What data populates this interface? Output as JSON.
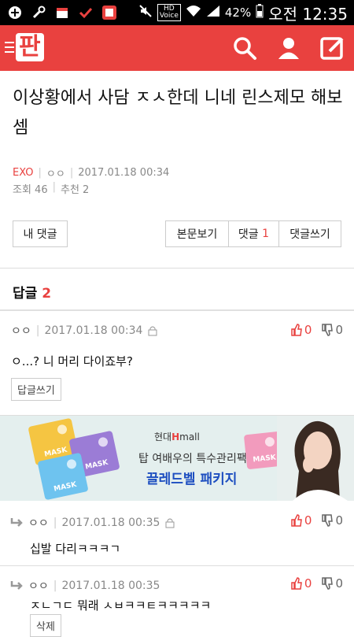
{
  "status_bar": {
    "hd_label": "HD",
    "voice_label": "Voice",
    "battery": "42%",
    "time": "오전 12:35"
  },
  "app": {
    "logo_text": "판"
  },
  "post": {
    "title": "이상황에서 사담 ㅈㅅ한데 니네 린스제모 해보셈",
    "category": "EXO",
    "author": "ㅇㅇ",
    "date": "2017.01.18 00:34",
    "views": "조회 46",
    "recommends": "추천 2"
  },
  "buttons": {
    "my_comments": "내 댓글",
    "view_post": "본문보기",
    "comments_label": "댓글",
    "comments_count": "1",
    "write_comment": "댓글쓰기"
  },
  "replies_section": {
    "label": "답글",
    "count": "2"
  },
  "comments": [
    {
      "author": "ㅇㅇ",
      "date": "2017.01.18 00:34",
      "up": "0",
      "down": "0",
      "text": "ㅇ...? 니 머리 다이죠부?",
      "action": "답글쓰기"
    },
    {
      "author": "ㅇㅇ",
      "date": "2017.01.18 00:35",
      "up": "0",
      "down": "0",
      "text": "십발 다리ㅋㅋㅋㄱ"
    },
    {
      "author": "ㅇㅇ",
      "date": "2017.01.18 00:35",
      "up": "0",
      "down": "0",
      "text": "ㅈㄴㄱㄷ 뭐래 ㅅㅂㅋㅋㅌㅋㅋㅋㅋㅋ",
      "action": "삭제"
    }
  ],
  "ad": {
    "brand_prefix": "현대",
    "brand_h": "H",
    "brand_suffix": "mall",
    "line1": "탑 여배우의 특수관리팩",
    "line2": "끌레드벨 패키지",
    "mask_label": "MASK"
  },
  "colors": {
    "accent": "#e9413f",
    "ad_bg": "#e4efee",
    "ad_text": "#1d4ec0"
  }
}
